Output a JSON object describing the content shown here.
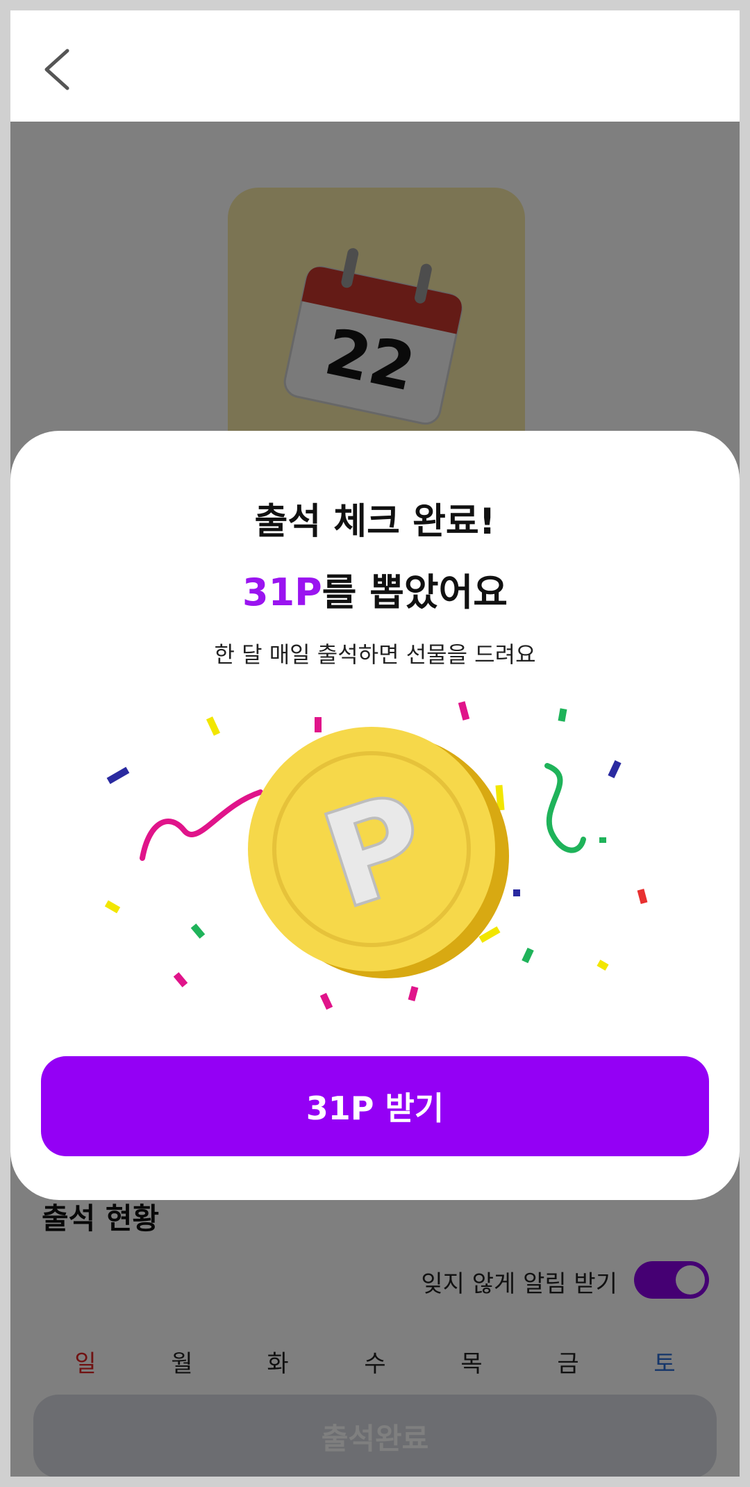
{
  "background": {
    "section_title": "출석 현황",
    "reminder_label": "잊지 않게 알림 받기",
    "reminder_enabled": true,
    "weekdays": [
      "일",
      "월",
      "화",
      "수",
      "목",
      "금",
      "토"
    ],
    "attend_button": "출석완료",
    "calendar_day": "22",
    "colors": {
      "toggle": "#8a00e6",
      "sunday": "#e02424",
      "saturday": "#2b6cd4"
    }
  },
  "modal": {
    "title": "출석 체크 완료!",
    "points": "31P",
    "subtitle_suffix": "를 뽑았어요",
    "description": "한 달 매일 출석하면 선물을 드려요",
    "coin_letter": "P",
    "claim_button": "31P 받기",
    "colors": {
      "accent": "#9400f5",
      "points_text": "#9a14f0"
    }
  },
  "icons": {
    "back": "chevron-left-icon"
  }
}
